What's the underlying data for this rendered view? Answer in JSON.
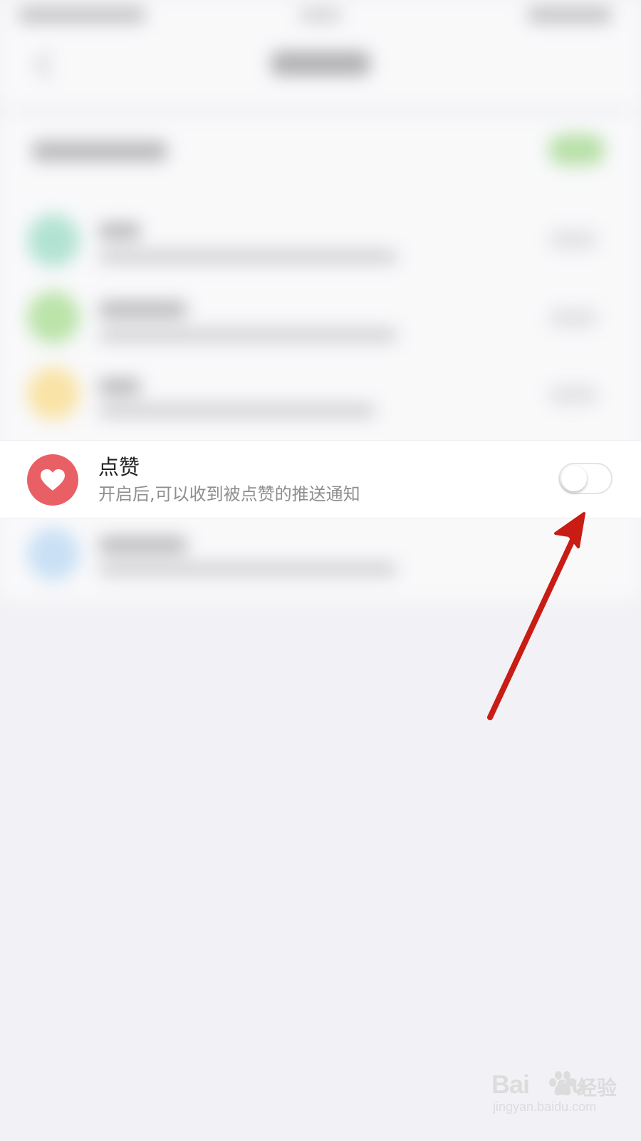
{
  "notification_settings": {
    "like_row": {
      "title": "点赞",
      "description": "开启后,可以收到被点赞的推送通知",
      "icon": "heart-icon",
      "icon_bg_color": "#e86066",
      "toggle_state": "off"
    }
  },
  "annotation": {
    "arrow_color": "#c81c14"
  },
  "watermark": {
    "brand_prefix": "Bai",
    "brand_suffix": "du",
    "brand_cn": "经验",
    "url": "jingyan.baidu.com"
  }
}
